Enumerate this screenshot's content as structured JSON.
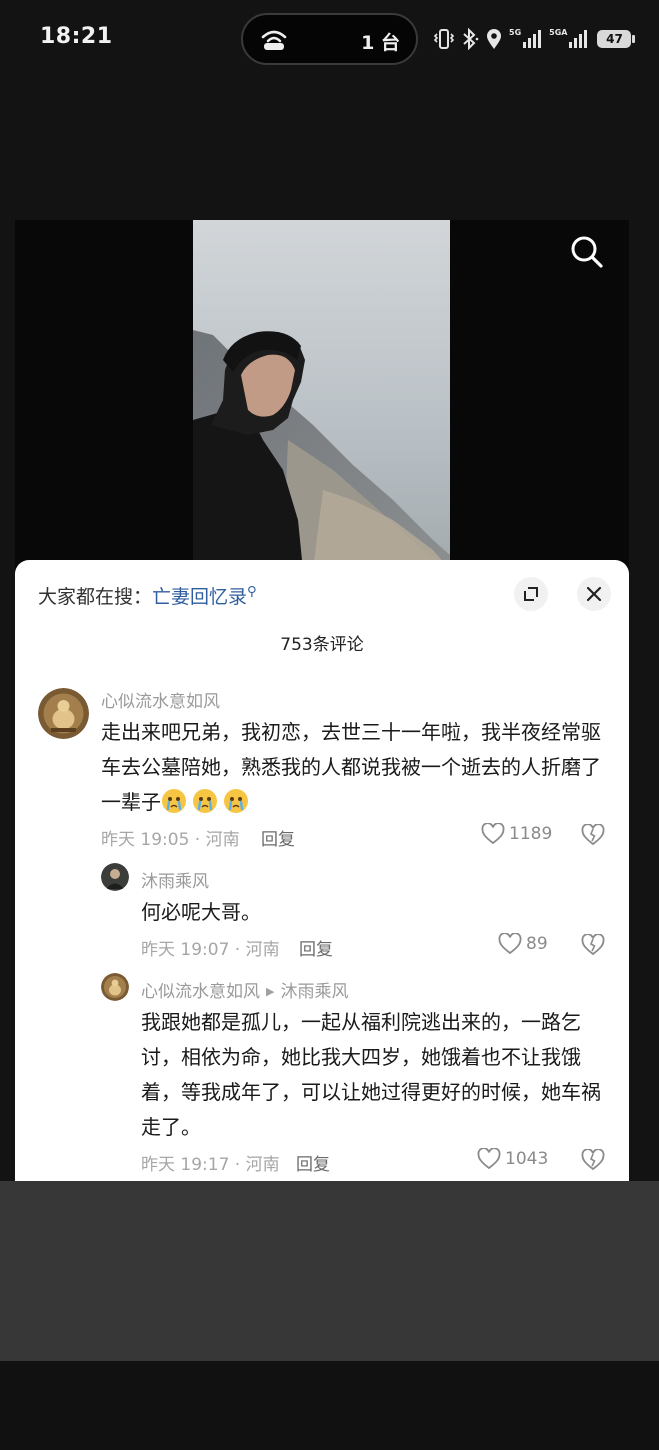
{
  "status_bar": {
    "time": "18:21",
    "island_count": "1 台",
    "signal1_label": "5G",
    "signal2_label": "5GA",
    "battery": "47",
    "icons": [
      "hotspot-icon",
      "vibrate-icon",
      "bluetooth-icon",
      "location-icon",
      "signal-icon",
      "battery-icon"
    ]
  },
  "video": {
    "search_icon": "search-icon"
  },
  "sheet": {
    "search_prefix": "大家都在搜：",
    "search_keyword": "亡妻回忆录",
    "comment_count": "753条评论"
  },
  "comments": [
    {
      "user": "心似流水意如风",
      "text": "走出来吧兄弟，我初恋，去世三十一年啦，我半夜经常驱车去公墓陪她，熟悉我的人都说我被一个逝去的人折磨了一辈子",
      "emojis": [
        "crying-emoji",
        "crying-emoji",
        "crying-emoji"
      ],
      "meta": "昨天 19:05 · 河南",
      "reply_label": "回复",
      "likes": "1189"
    },
    {
      "user": "沐雨乘风",
      "text": "何必呢大哥。",
      "meta": "昨天 19:07 · 河南",
      "reply_label": "回复",
      "likes": "89"
    },
    {
      "user": "心似流水意如风",
      "reply_to": "沐雨乘风",
      "text": "我跟她都是孤儿，一起从福利院逃出来的，一路乞讨，相依为命，她比我大四岁，她饿着也不让我饿着，等我成年了，可以让她过得更好的时候，她车祸走了。",
      "meta": "昨天 19:17 · 河南",
      "reply_label": "回复",
      "likes": "1043"
    }
  ],
  "colors": {
    "background": "#131313",
    "sheet": "#ffffff",
    "link": "#2f5e9e",
    "meta_text": "#a6a6a6"
  }
}
